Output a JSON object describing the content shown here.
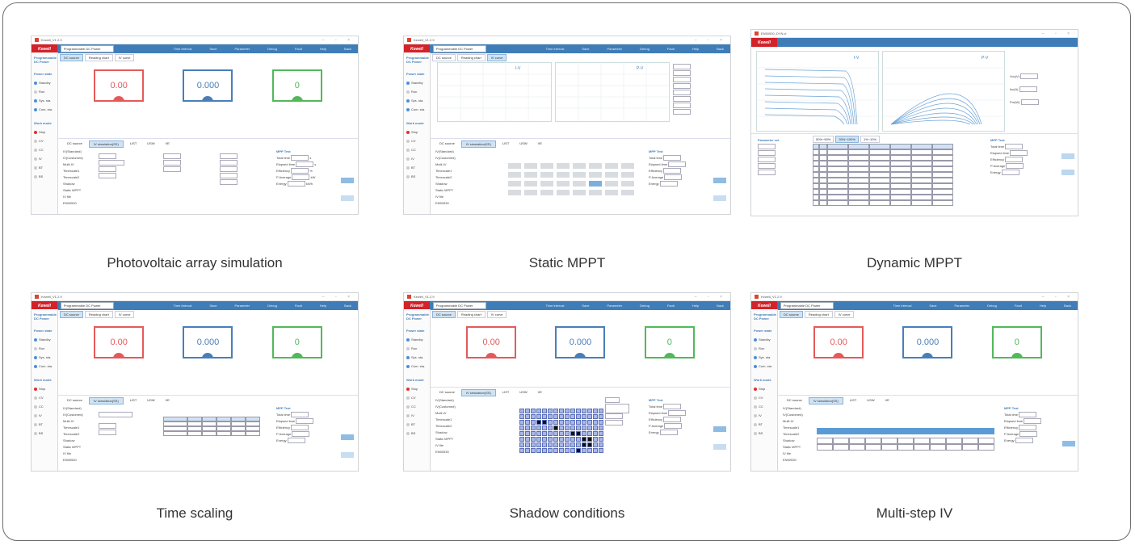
{
  "panels": [
    {
      "caption": "Photovoltaic array simulation",
      "window_title": "Kewell_V1.2.9",
      "brand": "Kewell",
      "device_select": "Programmable DC Power",
      "menu": [
        "Time interval",
        "Save",
        "Parameter",
        "Debug",
        "Fault",
        "Help",
        "Back"
      ],
      "top_tabs": [
        "DC source",
        "Reading chart",
        "IV curve"
      ],
      "lower_tabs": [
        "DC source",
        "IV simulation(SS)",
        "LIST",
        "USW",
        "VE"
      ],
      "meters": [
        "0.00",
        "0.000",
        "0"
      ],
      "meter_units": [
        "V",
        "A",
        "W"
      ]
    },
    {
      "caption": "Static MPPT",
      "window_title": "Kewell_V1.2.9",
      "brand": "Kewell",
      "device_select": "Programmable DC Power",
      "menu": [
        "Time interval",
        "Save",
        "Parameter",
        "Debug",
        "Fault",
        "Help",
        "Back"
      ],
      "top_tabs": [
        "DC source",
        "Reading chart",
        "IV curve"
      ],
      "lower_tabs": [
        "DC source",
        "IV simulation(SS)",
        "LIST",
        "USW",
        "VE"
      ],
      "plot_titles": [
        "I-V",
        "P-V"
      ]
    },
    {
      "caption": "Dynamic MPPT",
      "window_title": "EN50530_DYN.vi",
      "brand": "Kewell",
      "plot_titles": [
        "I-V",
        "P-V"
      ],
      "side_labels": [
        "Voc(V)",
        "Isc(A)",
        "Pm(W)"
      ],
      "side_values": [
        "0",
        "0",
        "0"
      ],
      "table_title": "Parameter set",
      "table_tabs": [
        "50%~50%",
        "30%~100%",
        "1%~10%"
      ]
    },
    {
      "caption": "Time scaling",
      "window_title": "Kewell_V1.2.9",
      "brand": "Kewell",
      "device_select": "Programmable DC Power",
      "menu": [
        "Time interval",
        "Save",
        "Parameter",
        "Debug",
        "Fault",
        "Help",
        "Back"
      ],
      "top_tabs": [
        "DC source",
        "Reading chart",
        "IV curve"
      ],
      "lower_tabs": [
        "DC source",
        "IV simulation(SS)",
        "LIST",
        "USW",
        "VE"
      ],
      "meters": [
        "0.00",
        "0.000",
        "0"
      ],
      "meter_units": [
        "V",
        "A",
        "W"
      ]
    },
    {
      "caption": "Shadow conditions",
      "window_title": "Kewell_V1.2.9",
      "brand": "Kewell",
      "device_select": "Programmable DC Power",
      "menu": [
        "Time interval",
        "Save",
        "Parameter",
        "Debug",
        "Fault",
        "Help",
        "Back"
      ],
      "top_tabs": [
        "DC source",
        "Reading chart",
        "IV curve"
      ],
      "lower_tabs": [
        "DC source",
        "IV simulation(SS)",
        "LIST",
        "USW",
        "VE"
      ],
      "meters": [
        "0.00",
        "0.000",
        "0"
      ],
      "meter_units": [
        "V",
        "A",
        "W"
      ]
    },
    {
      "caption": "Multi-step IV",
      "window_title": "Kewell_V1.2.9",
      "brand": "Kewell",
      "device_select": "Programmable DC Power",
      "menu": [
        "Time interval",
        "Save",
        "Parameter",
        "Debug",
        "Fault",
        "Help",
        "Back"
      ],
      "top_tabs": [
        "DC source",
        "Reading chart",
        "IV curve"
      ],
      "lower_tabs": [
        "DC source",
        "IV simulation(SS)",
        "LIST",
        "USW",
        "VE"
      ],
      "meters": [
        "0.00",
        "0.000",
        "0"
      ],
      "meter_units": [
        "V",
        "A",
        "W"
      ]
    }
  ],
  "sidebar": {
    "mode": "Programmable DC Power",
    "power_state_title": "Power state",
    "power_state_items": [
      "Standby",
      "Run",
      "Sys. sta.",
      "Com. sta."
    ],
    "work_mode_title": "Work mode",
    "work_mode_items": [
      "Stop",
      "CV",
      "CC",
      "IV",
      "BT",
      "BS"
    ]
  },
  "mppt": {
    "title": "MPP Test",
    "graph": "Graph",
    "rows": [
      "Total time",
      "Elapsed time",
      "Efficiency",
      "P Average",
      "Energy"
    ],
    "values": [
      "300",
      "0",
      "0",
      "0",
      "0"
    ],
    "units": [
      "s",
      "s",
      "%",
      "kW",
      "kWh"
    ]
  },
  "iv_list": [
    "IV(Standard)",
    "IV(Customed)",
    "Multi-IV",
    "Timescale1",
    "Timescale2",
    "Shadow",
    "Static MPPT",
    "IV file",
    "EN50530"
  ],
  "colors": {
    "menu": "#3f7db8",
    "brand": "#d2222a",
    "meter_red": "#e45a5a",
    "meter_blue": "#4a7eb8",
    "meter_green": "#52b85a"
  }
}
